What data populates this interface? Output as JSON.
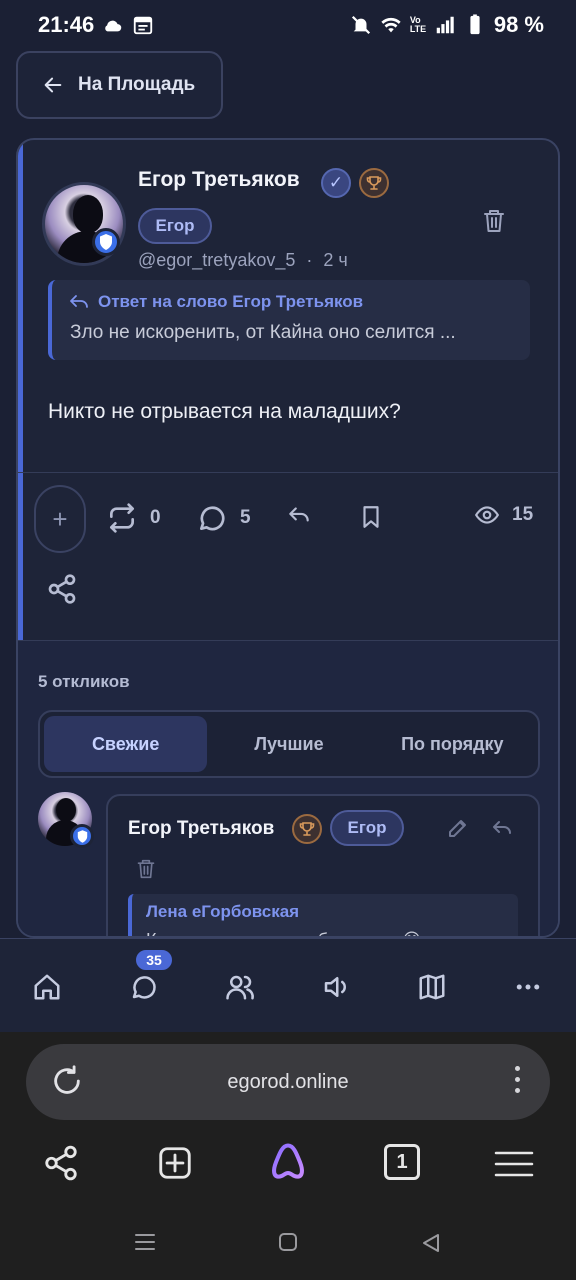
{
  "statusbar": {
    "time": "21:46",
    "battery": "98 %",
    "volte": "Vo LTE"
  },
  "header": {
    "back_label": "На Площадь"
  },
  "post": {
    "author_name": "Егор Третьяков",
    "author_badge": "Егор",
    "handle": "@egor_tretyakov_5",
    "separator": "·",
    "time_ago": "2 ч",
    "reply_title": "Ответ на слово Егор Третьяков",
    "reply_text": "Зло не искоренить, от Кайна оно селится ...",
    "text": "Никто не отрывается на маладших?",
    "reposts": "0",
    "comments": "5",
    "views": "15"
  },
  "responses": {
    "count_label": "5 откликов",
    "tabs": [
      "Свежие",
      "Лучшие",
      "По порядку"
    ],
    "active_tab": "Свежие",
    "comment": {
      "author_name": "Егор Третьяков",
      "author_badge": "Егор",
      "quote_name": "Лена еГорбовская",
      "quote_text": "Как страшна жыть с братьями 😅"
    }
  },
  "bottom_nav": {
    "messages_badge": "35",
    "items": [
      "home-icon",
      "chat-icon",
      "users-icon",
      "sound-icon",
      "map-icon",
      "more-icon"
    ]
  },
  "browser": {
    "url": "egorod.online",
    "tab_count": "1"
  },
  "colors": {
    "accent": "#4a68d6",
    "background": "#1b2034",
    "card": "#1e2438"
  }
}
